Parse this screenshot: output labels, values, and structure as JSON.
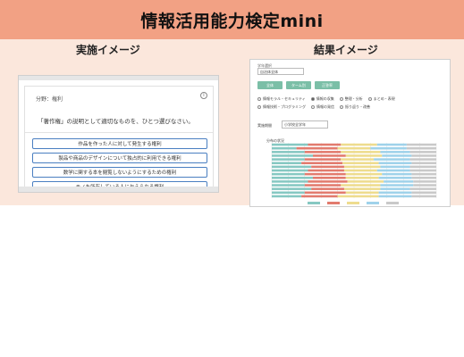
{
  "banner": {
    "title": "情報活用能力検定mini"
  },
  "sections": {
    "left_label": "実施イメージ",
    "right_label": "結果イメージ"
  },
  "left_screen": {
    "field_label": "分野：権利",
    "info_icon": "info-icon",
    "prompt": "「著作権」の説明として適切なものを、ひとつ選びなさい。",
    "choices": [
      "作品を作った人に対して発生する権利",
      "製品や商品のデザインについて独占的に利用できる権利",
      "数学に関する本を閲覧しないようにするための権利",
      "モノを所有している人に与えられる権利"
    ]
  },
  "right_screen": {
    "top_label": "学年選択",
    "select_value": "自治体全体",
    "buttons": [
      "全体",
      "ターム別",
      "正答率"
    ],
    "radio_rows": [
      [
        {
          "label": "情報モラル・セキュリティ",
          "on": false
        },
        {
          "label": "情報の収集",
          "on": true
        },
        {
          "label": "整理・分析",
          "on": false
        },
        {
          "label": "まとめ・表現",
          "on": false
        }
      ],
      [
        {
          "label": "情報技術・プログラミング",
          "on": false
        },
        {
          "label": "情報の発信",
          "on": false
        },
        {
          "label": "振り返り・改善",
          "on": false
        }
      ]
    ],
    "period_label": "実施期間",
    "period_value": "小学校全学年",
    "chart_title": "分布の状況"
  },
  "chart_data": {
    "type": "bar",
    "orientation": "horizontal-stacked-100",
    "categories": [
      "",
      "",
      "",
      "",
      "",
      "",
      "",
      "",
      "",
      "",
      "",
      "",
      "",
      "",
      ""
    ],
    "series": [
      {
        "values": [
          22,
          15,
          20,
          25,
          20,
          18,
          24,
          22,
          20,
          25,
          22,
          20,
          24,
          20,
          18
        ]
      },
      {
        "values": [
          20,
          25,
          22,
          20,
          22,
          25,
          20,
          22,
          25,
          20,
          24,
          22,
          20,
          25,
          22
        ]
      },
      {
        "values": [
          22,
          20,
          24,
          22,
          20,
          22,
          22,
          20,
          22,
          20,
          22,
          24,
          22,
          20,
          25
        ]
      },
      {
        "values": [
          18,
          22,
          18,
          18,
          22,
          20,
          18,
          20,
          18,
          20,
          18,
          20,
          18,
          20,
          20
        ]
      },
      {
        "values": [
          18,
          18,
          16,
          15,
          16,
          15,
          16,
          16,
          15,
          15,
          14,
          14,
          16,
          15,
          15
        ]
      }
    ],
    "colors": [
      "#86c8c2",
      "#e27b6e",
      "#eedc8e",
      "#9fd2ea",
      "#c9c9c9"
    ],
    "xlim": [
      0,
      100
    ],
    "grid": true
  }
}
